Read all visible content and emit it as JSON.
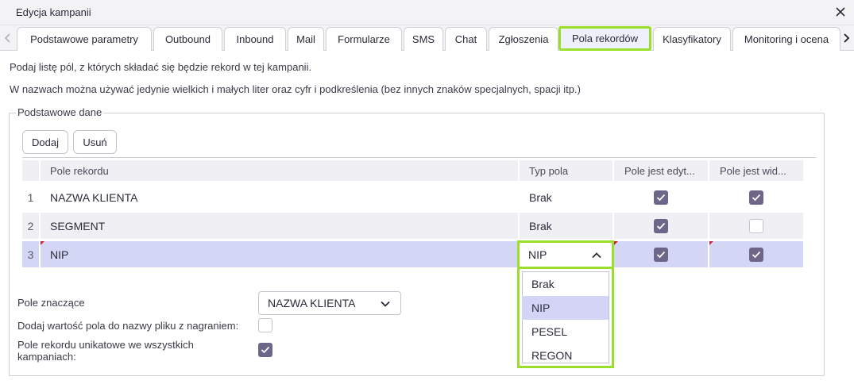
{
  "window": {
    "title": "Edycja kampanii"
  },
  "tabs": [
    "Podstawowe parametry",
    "Outbound",
    "Inbound",
    "Mail",
    "Formularze",
    "SMS",
    "Chat",
    "Zgłoszenia",
    "Pola rekordów",
    "Klasyfikatory",
    "Monitoring i ocena"
  ],
  "active_tab": "Pola rekordów",
  "info": {
    "line1": "Podaj listę pól, z których składać się będzie rekord w tej kampanii.",
    "line2": "W nazwach można używać jedynie wielkich i małych liter oraz cyfr i podkreślenia (bez innych znaków specjalnych, spacji itp.)"
  },
  "group": {
    "legend": "Podstawowe dane",
    "add_label": "Dodaj",
    "remove_label": "Usuń"
  },
  "table": {
    "headers": [
      "Pole rekordu",
      "Typ pola",
      "Pole jest edyt...",
      "Pole jest wid..."
    ],
    "rows": [
      {
        "num": "1",
        "field": "NAZWA KLIENTA",
        "type": "Brak",
        "editable": true,
        "visible": true
      },
      {
        "num": "2",
        "field": "SEGMENT",
        "type": "Brak",
        "editable": true,
        "visible": false
      },
      {
        "num": "3",
        "field": "NIP",
        "type": "NIP",
        "editable": true,
        "visible": true
      }
    ],
    "selected_row": 3
  },
  "type_dropdown": {
    "value": "NIP",
    "options": [
      "Brak",
      "NIP",
      "PESEL",
      "REGON"
    ],
    "selected_option": "NIP"
  },
  "form": {
    "significant_label": "Pole znaczące",
    "significant_value": "NAZWA KLIENTA",
    "add_to_filename_label": "Dodaj wartość pola do nazwy pliku z nagraniem:",
    "add_to_filename_checked": false,
    "unique_label_line1": "Pole rekordu unikatowe we wszystkich",
    "unique_label_line2": "kampaniach:",
    "unique_checked": true
  },
  "colors": {
    "accent_highlight": "#9ae02a",
    "checkbox_checked": "#6e6688",
    "selected_row": "#d4d6f6",
    "alt_row": "#f0f0f4",
    "dirty_marker": "#d0223a"
  }
}
